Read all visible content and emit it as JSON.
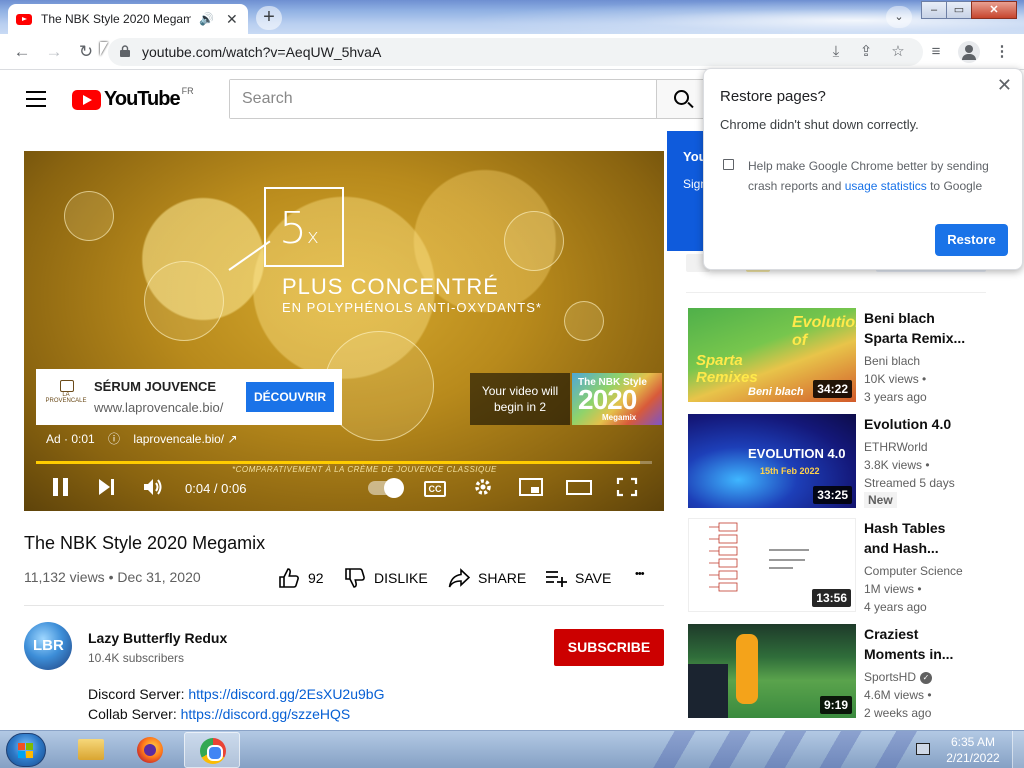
{
  "browser": {
    "tab_title": "The NBK Style 2020 Megamix",
    "tab_speaker": "🔊",
    "tab_close": "✕",
    "new_tab": "+",
    "tab_search": "⌄",
    "url": "youtube.com/watch?v=AeqUW_5hvaA",
    "min": "–",
    "max": "▭",
    "close": "✕"
  },
  "yt": {
    "logo_text": "YouTube",
    "country": "FR",
    "search_placeholder": "Search"
  },
  "player": {
    "promo_5x": "5",
    "promo_x": "x",
    "promo_line1": "PLUS CONCENTRÉ",
    "promo_line2": "EN POLYPHÉNOLS ANTI-OXYDANTS*",
    "promo_footnote": "*COMPARATIVEMENT À LA CRÈME DE JOUVENCE CLASSIQUE",
    "ad_logo": "LA PROVENCALE",
    "ad_title": "SÉRUM JOUVENCE",
    "ad_url": "www.laprovencale.bio/",
    "ad_cta": "DÉCOUVRIR",
    "ad_label": "Ad · 0:01",
    "ad_info": "ⓘ",
    "ad_domain": "laprovencale.bio/ ↗",
    "skip_text": "Your video will begin in 2",
    "skip_thumb_top": "The NBK Style",
    "skip_thumb_year": "2020",
    "skip_thumb_bottom": "Megamix",
    "time": "0:04 / 0:06",
    "cc": "CC",
    "progress_fraction": 0.98,
    "progress_color": "#ffcc00"
  },
  "video": {
    "title": "The NBK Style 2020 Megamix",
    "stats": "11,132 views • Dec 31, 2020",
    "likes": "92",
    "dislike": "DISLIKE",
    "share": "SHARE",
    "save": "SAVE",
    "more": "•••"
  },
  "channel": {
    "avatar_text": "LBR",
    "name": "Lazy Butterfly Redux",
    "subs": "10.4K subscribers",
    "subscribe": "SUBSCRIBE"
  },
  "description": {
    "line1_label": "Discord Server: ",
    "line1_link": "https://discord.gg/2EsXU2u9bG",
    "line2_label": "Collab Server: ",
    "line2_link": "https://discord.gg/szzeHQS"
  },
  "promo_peek": {
    "line1": "You",
    "line2": "Sign"
  },
  "recommendations": [
    {
      "title": "Beni blach Sparta Remix...",
      "channel": "Beni blach",
      "views": "10K views •",
      "age": "3 years ago",
      "duration": "34:22",
      "thumb_text1": "Evolution of",
      "thumb_text2": "Sparta Remixes",
      "thumb_text3": "Beni blach"
    },
    {
      "title": "Evolution 4.0",
      "channel": "ETHRWorld",
      "views": "3.8K views •",
      "age": "Streamed 5 days",
      "badge": "New",
      "duration": "33:25",
      "thumb_text1": "EVOLUTION 4.0",
      "thumb_text2": "15th Feb 2022"
    },
    {
      "title": "Hash Tables and Hash...",
      "channel": "Computer Science",
      "views": "1M views •",
      "age": "4 years ago",
      "duration": "13:56"
    },
    {
      "title": "Craziest Moments in...",
      "channel": "SportsHD",
      "views": "4.6M views •",
      "age": "2 weeks ago",
      "duration": "9:19"
    }
  ],
  "restore": {
    "title": "Restore pages?",
    "message": "Chrome didn't shut down correctly.",
    "help_prefix": "Help make Google Chrome better by sending crash reports and ",
    "help_link": "usage statistics",
    "help_suffix": " to Google",
    "button": "Restore",
    "close": "✕"
  },
  "taskbar": {
    "time": "6:35 AM",
    "date": "2/21/2022"
  }
}
